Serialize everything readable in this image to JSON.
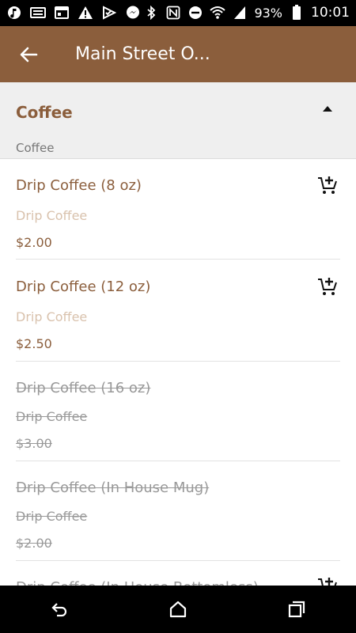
{
  "status_bar": {
    "battery": "93%",
    "time": "10:01"
  },
  "app_bar": {
    "title": "Main Street O..."
  },
  "section": {
    "title": "Coffee",
    "subtitle": "Coffee"
  },
  "items": [
    {
      "name": "Drip Coffee (8 oz)",
      "desc": "Drip Coffee",
      "price": "$2.00"
    },
    {
      "name": "Drip Coffee (12 oz)",
      "desc": "Drip Coffee",
      "price": "$2.50"
    },
    {
      "name": "Drip Coffee (16 oz)",
      "desc": "Drip Coffee",
      "price": "$3.00"
    },
    {
      "name": "Drip Coffee (In House Mug)",
      "desc": "Drip Coffee",
      "price": "$2.00"
    },
    {
      "name": "Drip Coffee (In House Bottomless)"
    }
  ],
  "colors": {
    "appbar": "#8b5e3c",
    "accent": "#8b5e3c",
    "muted": "#d9c2ad",
    "disabled": "#999999"
  }
}
